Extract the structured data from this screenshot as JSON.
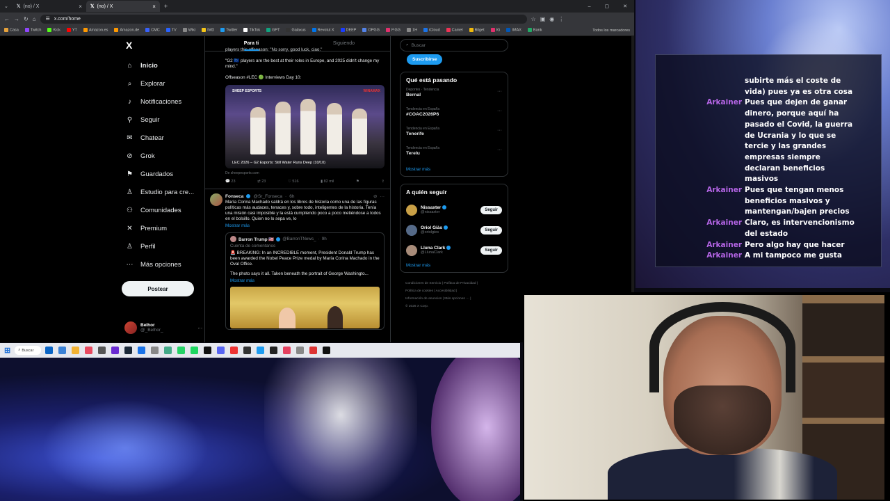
{
  "browser": {
    "tabs": [
      {
        "label": "(no) / X",
        "active": false
      },
      {
        "label": "(no) / X",
        "active": true
      }
    ],
    "url": "x.com/home",
    "bookmarks": [
      "Casa",
      "Twitch",
      "Kick",
      "YT",
      "Amazon.es",
      "Amazon.de",
      "CMC",
      "TV",
      "Wiki",
      "IMD",
      "Twitter",
      "TikTok",
      "GPT",
      "Galaxus",
      "Revolut X",
      "DEEP",
      "OPGG",
      "P.GG",
      "1H",
      "iCloud",
      "Camel",
      "Bitget",
      "IG",
      "IMAX",
      "Bank"
    ],
    "bookmarks_folder": "Todos los marcadores"
  },
  "x": {
    "logo": "X",
    "nav": [
      {
        "label": "Inicio",
        "icon": "home-icon",
        "glyph": "⌂"
      },
      {
        "label": "Explorar",
        "icon": "search-icon",
        "glyph": "⌕"
      },
      {
        "label": "Notificaciones",
        "icon": "bell-icon",
        "glyph": "♪"
      },
      {
        "label": "Seguir",
        "icon": "follow-icon",
        "glyph": "⚲"
      },
      {
        "label": "Chatear",
        "icon": "chat-icon",
        "glyph": "✉"
      },
      {
        "label": "Grok",
        "icon": "grok-icon",
        "glyph": "⊘"
      },
      {
        "label": "Guardados",
        "icon": "bookmark-icon",
        "glyph": "⚑"
      },
      {
        "label": "Estudio para cre...",
        "icon": "studio-icon",
        "glyph": "♙"
      },
      {
        "label": "Comunidades",
        "icon": "communities-icon",
        "glyph": "⚇"
      },
      {
        "label": "Premium",
        "icon": "premium-icon",
        "glyph": "✕"
      },
      {
        "label": "Perfil",
        "icon": "profile-icon",
        "glyph": "♙"
      },
      {
        "label": "Más opciones",
        "icon": "more-options-icon",
        "glyph": "⋯"
      }
    ],
    "post_button": "Postear",
    "user": {
      "name": "Belhor",
      "handle": "@_Belhor_"
    },
    "feed_tabs": [
      "Para ti",
      "Siguiendo"
    ],
    "post1": {
      "lines": [
        "players this offseason: \"No sorry, good luck, ciao.\"",
        "\"G2 🇪🇺 players are the best at their roles in Europe, and 2025 didn't change my mind.\"",
        "Offseason #LEC 🟢 Interviews Day 10:"
      ],
      "media_caption": "LEC 2026 – G2 Esports: Still Water Runs Deep (10/10)",
      "media_tag": "SHEEP ESPORTS",
      "media_tag2": "WINAMAX",
      "source": "De sheepesports.com",
      "stats": {
        "replies": "23",
        "reposts": "23",
        "likes": "516",
        "views": "82 mil"
      }
    },
    "post2": {
      "name": "Fonseca",
      "handle": "@Sr_Fonseca",
      "time": "6h",
      "text": "María Corina Machado saldrá en los libros de historia como una de las figuras políticas más audaces, tenaces y, sobre todo, inteligentes de la historia. Tenía una misión casi imposible y la está cumpliendo poco a poco metiéndose a todos en el bolsillo. Quien no lo sepa ve, lo",
      "show_more": "Mostrar más",
      "quote": {
        "name": "Barron Trump 🇺🇸",
        "handle": "@BarronTNews_",
        "time": "9h",
        "sub": "Cuenta de comentarios",
        "text": "🚨 BREAKING: In an INCREDIBLE moment, President Donald Trump has been awarded the Nobel Peace Prize medal by María Corina Machado in the Oval Office.",
        "text2": "The photo says it all. Taken beneath the portrait of George Washingto...",
        "show_more": "Mostrar más"
      }
    },
    "search_placeholder": "Buscar",
    "subscribe": "Suscribirse",
    "trends_title": "Qué está pasando",
    "trends": [
      {
        "sub": "Deportes · Tendencia",
        "name": "Bernal"
      },
      {
        "sub": "Tendencia en España",
        "name": "#COAC2026P6"
      },
      {
        "sub": "Tendencia en España",
        "name": "Tenerife"
      },
      {
        "sub": "Tendencia en España",
        "name": "Terelu"
      }
    ],
    "trends_more": "Mostrar más",
    "follow_title": "A quién seguir",
    "follow": [
      {
        "name": "Nissaxter",
        "handle": "@nissaxter",
        "color": "#c9a046"
      },
      {
        "name": "Oriol Giàs",
        "handle": "@oriolgies",
        "color": "#556a88"
      },
      {
        "name": "Lluna Clark",
        "handle": "@LlunaClark",
        "color": "#a88c7a"
      }
    ],
    "follow_button": "Seguir",
    "follow_more": "Mostrar más",
    "legal": [
      "Condiciones de Servicio",
      "Política de Privacidad",
      "Política de cookies",
      "Accesibilidad",
      "Información de anuncios",
      "Más opciones ···",
      "© 2026 X Corp."
    ]
  },
  "taskbar": {
    "search": "Buscar"
  },
  "chat": {
    "name_color": "#b565e6",
    "lines": [
      {
        "who": "",
        "text": "subirte más el coste de vida) pues ya es otra cosa"
      },
      {
        "who": "Arkainer",
        "text": "Pues que dejen de ganar dinero, porque aquí ha pasado el Covid, la guerra de Ucrania y lo que se tercie y las grandes empresas siempre declaran beneficios masivos"
      },
      {
        "who": "Arkainer",
        "text": "Pues que tengan menos beneficios masivos y mantengan/bajen precios"
      },
      {
        "who": "Arkainer",
        "text": "Claro, es intervencionismo del estado"
      },
      {
        "who": "Arkainer",
        "text": "Pero algo hay que hacer"
      },
      {
        "who": "Arkainer",
        "text": "A mi tampoco me gusta"
      }
    ]
  }
}
